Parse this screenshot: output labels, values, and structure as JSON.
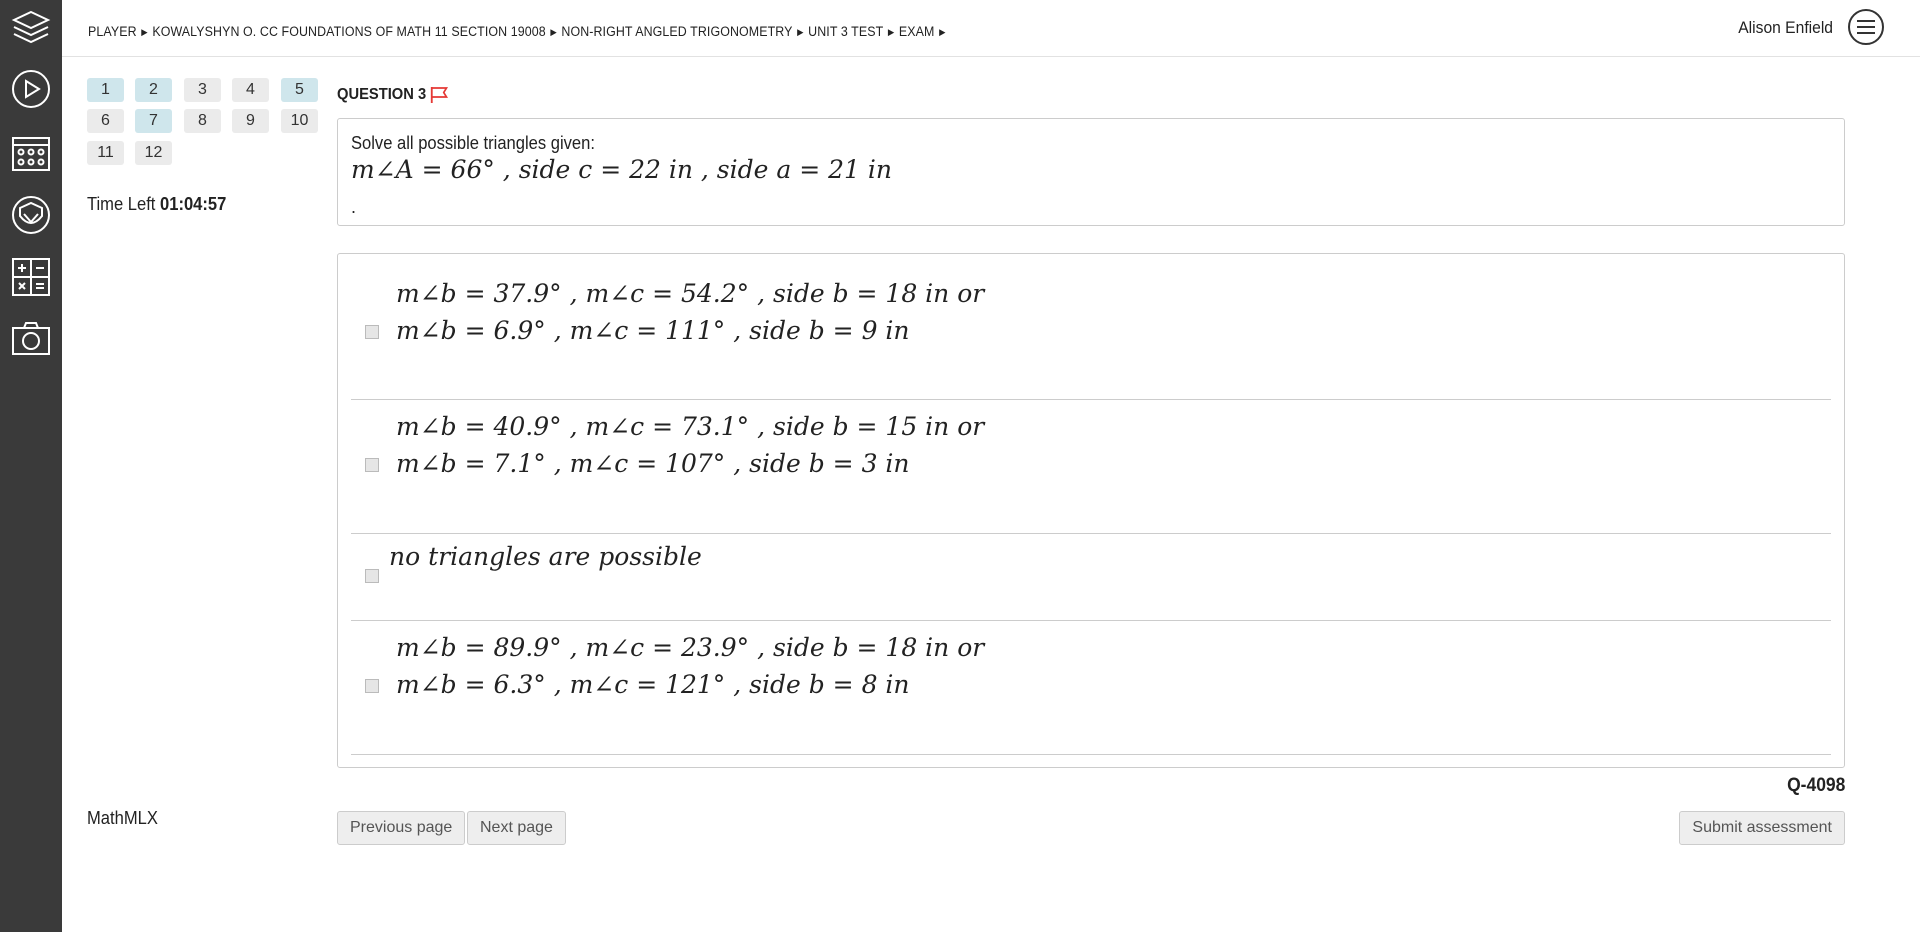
{
  "sidebar": {
    "items": [
      {
        "icon": "layers-icon"
      },
      {
        "icon": "play-icon"
      },
      {
        "icon": "calendar-icon"
      },
      {
        "icon": "badge-icon"
      },
      {
        "icon": "calculator-icon"
      },
      {
        "icon": "camera-icon"
      }
    ]
  },
  "breadcrumb": [
    "PLAYER",
    "KOWALYSHYN O. CC FOUNDATIONS OF MATH 11 SECTION 19008",
    "NON-RIGHT ANGLED TRIGONOMETRY",
    "UNIT 3 TEST",
    "EXAM"
  ],
  "user": {
    "name": "Alison Enfield"
  },
  "question_nav": [
    {
      "label": "1",
      "answered": true
    },
    {
      "label": "2",
      "answered": true
    },
    {
      "label": "3",
      "answered": false
    },
    {
      "label": "4",
      "answered": false
    },
    {
      "label": "5",
      "answered": true
    },
    {
      "label": "6",
      "answered": false
    },
    {
      "label": "7",
      "answered": true
    },
    {
      "label": "8",
      "answered": false
    },
    {
      "label": "9",
      "answered": false
    },
    {
      "label": "10",
      "answered": false
    },
    {
      "label": "11",
      "answered": false
    },
    {
      "label": "12",
      "answered": false
    }
  ],
  "timer": {
    "label": "Time Left",
    "value": "01:04:57"
  },
  "brand": "MathMLX",
  "question": {
    "title": "QUESTION 3",
    "prompt": "Solve all possible triangles given:",
    "given": "m∠A = 66° , side c = 22 in , side a = 21 in",
    "trailing": "."
  },
  "options": [
    {
      "lines": [
        "m∠b = 37.9° , m∠c = 54.2° , side b = 18 in or",
        "m∠b = 6.9° , m∠c = 111° , side b = 9 in"
      ]
    },
    {
      "lines": [
        "m∠b = 40.9° , m∠c = 73.1° , side b = 15 in or",
        "m∠b = 7.1° , m∠c = 107° , side b = 3 in"
      ]
    },
    {
      "lines": [
        "no triangles are possible"
      ]
    },
    {
      "lines": [
        "m∠b = 89.9° , m∠c = 23.9° , side b = 18 in or",
        "m∠b = 6.3° , m∠c = 121° , side b = 8 in"
      ]
    }
  ],
  "question_id": "Q-4098",
  "buttons": {
    "prev": "Previous page",
    "next": "Next page",
    "submit": "Submit assessment"
  },
  "colors": {
    "sidebar": "#3a3a3a",
    "answered": "#cfe6ec",
    "unanswered": "#ebebeb",
    "flag": "#e53935"
  }
}
